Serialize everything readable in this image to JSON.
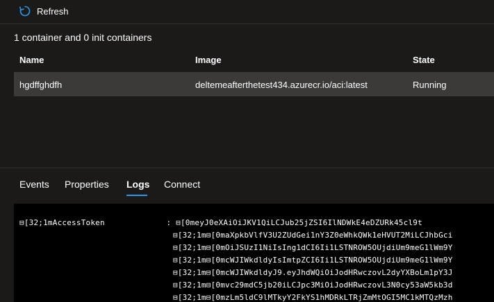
{
  "toolbar": {
    "refresh_label": "Refresh"
  },
  "summary": "1 container and 0 init containers",
  "table": {
    "headers": [
      "Name",
      "Image",
      "State"
    ],
    "rows": [
      [
        "hgdffghdfh",
        "deltemeafterthetest434.azurecr.io/aci:latest",
        "Running"
      ]
    ]
  },
  "tabs": [
    {
      "label": "Events"
    },
    {
      "label": "Properties"
    },
    {
      "label": "Logs",
      "active": true
    },
    {
      "label": "Connect"
    }
  ],
  "logs": {
    "lines": [
      "⊟[32;1mAccessToken             : ⊟[0meyJ0eXAiOiJKV1QiLCJub25jZSI6IlNDWkE4eDZURk45cl9t",
      "⊟[32;1m⊟[0maXpkbVlfV3U2ZUdGei1nY3Z0eWhkQWk1eHVUT2MiLCJhbGci",
      "⊟[32;1m⊟[0mOiJSUzI1NiIsIng1dCI6Ii1LSTNROW5OUjdiUm9meG1lWm9Y",
      "⊟[32;1m⊟[0mcWJIWkdldyIsImtpZCI6Ii1LSTNROW5OUjdiUm9meG1lWm9Y",
      "⊟[32;1m⊟[0mcWJIWkdldyJ9.eyJhdWQiOiJodHRwczovL2dyYXBoLm1pY3J",
      "⊟[32;1m⊟[0mvc29mdC5jb20iLCJpc3MiOiJodHRwczovL3N0cy53aW5kb3d",
      "⊟[32;1m⊟[0mzLm5ldC9lMTkyY2FkYS1hMDRkLTRjZmMtOGI5MC1kMTQzMzh"
    ]
  },
  "colors": {
    "accent": "#2899f5",
    "background": "#1b1a19",
    "row_highlight": "#3b3a39",
    "log_background": "#000000"
  }
}
